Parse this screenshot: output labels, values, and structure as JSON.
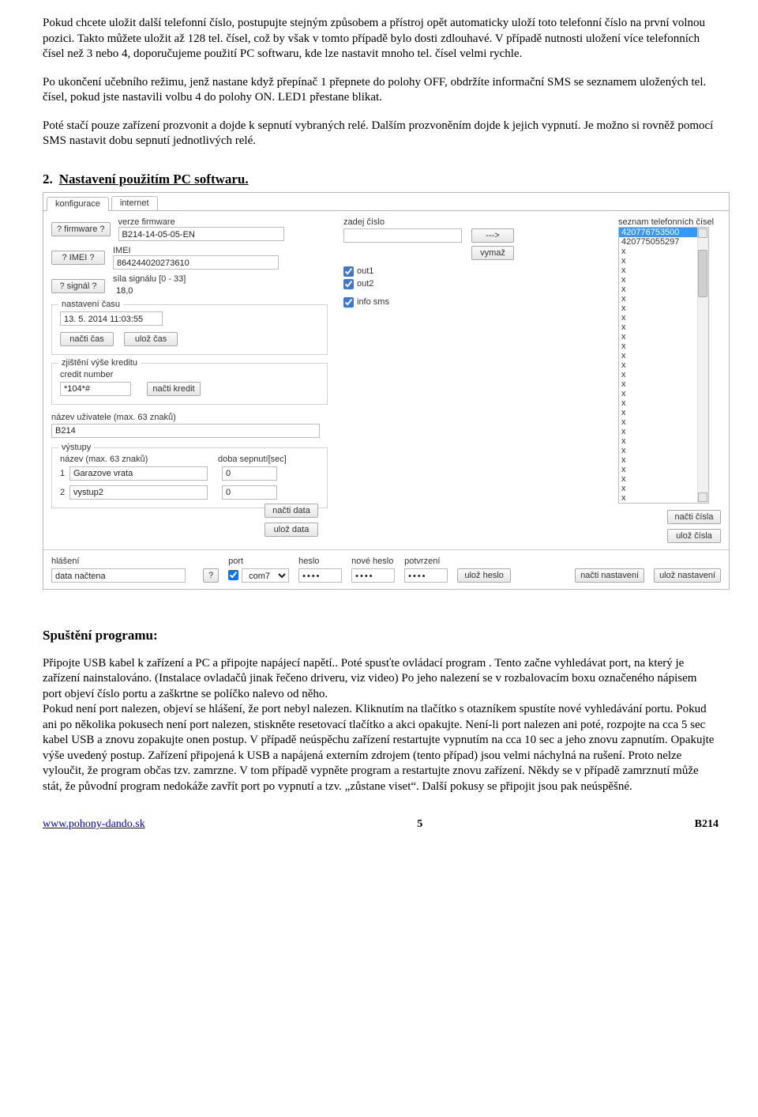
{
  "paragraphs": {
    "p1": "Pokud chcete uložit další telefonní číslo, postupujte stejným způsobem a přístroj opět automaticky uloží toto telefonní číslo na první volnou pozici. Takto můžete uložit až 128 tel. čísel, což by však v tomto případě bylo dosti zdlouhavé. V případě nutnosti uložení více telefonních čísel než 3 nebo 4, doporučujeme použití PC softwaru, kde lze nastavit mnoho tel. čísel velmi rychle.",
    "p2": "Po ukončení učebního režimu, jenž nastane když přepínač 1 přepnete do polohy OFF, obdržíte informační SMS se seznamem uložených tel. čísel, pokud jste nastavili volbu 4 do polohy ON. LED1 přestane blikat.",
    "p3": "Poté stačí pouze zařízení prozvonit a dojde k sepnutí vybraných relé. Dalším prozvoněním dojde k jejich vypnutí. Je možno si rovněž pomocí SMS nastavit dobu sepnutí jednotlivých relé."
  },
  "section": {
    "num": "2.",
    "title": "Nastavení použitím  PC softwaru."
  },
  "app": {
    "tabs": {
      "t1": "konfigurace",
      "t2": "internet"
    },
    "left": {
      "firmware_btn": "? firmware ?",
      "imei_btn": "? IMEI ?",
      "signal_btn": "? signál ?",
      "labels": {
        "fw": "verze firmware",
        "imei": "IMEI",
        "signal": "síla signálu [0 - 33]"
      },
      "values": {
        "fw": "B214-14-05-05-EN",
        "imei": "864244020273610",
        "signal": "18,0"
      },
      "time_box_title": "nastavení času",
      "time_value": "13. 5. 2014 11:03:55",
      "read_time": "načti čas",
      "save_time": "ulož čas",
      "credit_box_title": "zjištění výše kreditu",
      "credit_number_lbl": "credit number",
      "credit_number_val": "*104*#",
      "read_credit": "načti kredit",
      "username_lbl": "název uživatele (max. 63 znaků)",
      "username_val": "B214",
      "outputs_box_title": "výstupy",
      "out_name_header": "název (max.  63 znaků)",
      "out_dur_header": "doba sepnutí[sec]",
      "out1_idx": "1",
      "out2_idx": "2",
      "out1_name": "Garazove vrata",
      "out2_name": "vystup2",
      "out1_dur": "0",
      "out2_dur": "0",
      "read_data": "načti data",
      "save_data": "ulož data"
    },
    "right": {
      "enter_number_lbl": "zadej číslo",
      "phone_list_lbl": "seznam telefonních čísel",
      "arrow_btn": "--->",
      "delete_btn": "vymaž",
      "out1_lbl": "out1",
      "out2_lbl": "out2",
      "infosms_lbl": "info sms",
      "phone_list": [
        "420776753500",
        "420775055297",
        "x",
        "x",
        "x",
        "x",
        "x",
        "x",
        "x",
        "x",
        "x",
        "x",
        "x",
        "x",
        "x",
        "x",
        "x",
        "x",
        "x",
        "x",
        "x",
        "x",
        "x",
        "x",
        "x",
        "x",
        "x",
        "x",
        "x"
      ],
      "read_numbers": "načti čísla",
      "save_numbers": "ulož čísla"
    },
    "footer": {
      "status_lbl": "hlášení",
      "status_val": "data načtena",
      "q_btn": "?",
      "port_lbl": "port",
      "port_val": "com7",
      "pw_lbl": "heslo",
      "newpw_lbl": "nové heslo",
      "conf_lbl": "potvrzení",
      "save_pw": "ulož heslo",
      "read_settings": "načti nastavení",
      "save_settings": "ulož nastavení"
    }
  },
  "run": {
    "heading": "Spuštění programu:",
    "body": "Připojte USB kabel k zařízení a PC a připojte napájecí napětí.. Poté spusťte ovládací program . Tento začne vyhledávat port, na který je zařízení nainstalováno. (Instalace ovladačů jinak řečeno driveru, viz video) Po jeho nalezení se v rozbalovacím boxu označeného nápisem port objeví číslo portu a zaškrtne se políčko nalevo od něho.\nPokud není port nalezen, objeví se hlášení, že port nebyl nalezen. Kliknutím na tlačítko s otazníkem spustíte nové vyhledávání portu. Pokud ani po několika pokusech není port nalezen, stiskněte resetovací tlačítko a akci opakujte. Není-li port nalezen ani poté, rozpojte na cca 5 sec kabel USB a znovu zopakujte onen postup. V případě neúspěchu zařízení restartujte vypnutím na cca 10 sec a jeho znovu zapnutím. Opakujte výše uvedený postup. Zařízení připojená k USB a napájená externím zdrojem (tento případ) jsou velmi náchylná na rušení. Proto nelze vyloučit, že program občas tzv. zamrzne. V tom případě vypněte program a restartujte znovu zařízení. Někdy se v případě zamrznutí může stát, že původní program nedokáže zavřít port po vypnutí a tzv. „zůstane viset“. Další pokusy se připojit jsou pak neúspěšné."
  },
  "page_footer": {
    "link": "www.pohony-dando.sk",
    "page": "5",
    "code": "B214"
  }
}
